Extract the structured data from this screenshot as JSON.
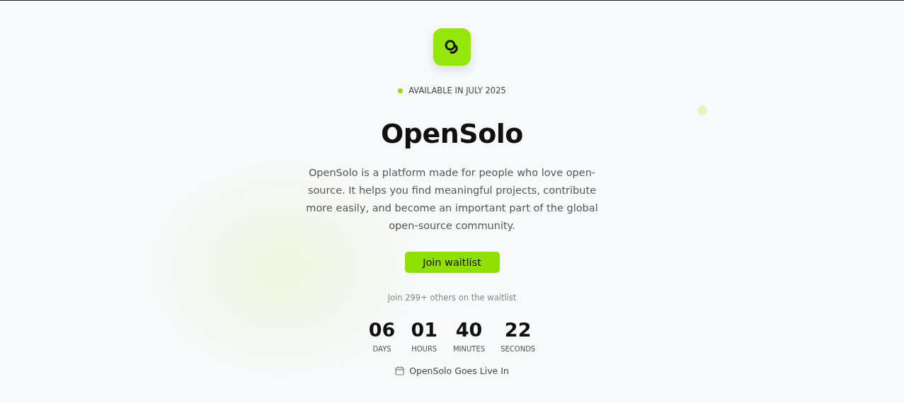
{
  "badge": {
    "text": "AVAILABLE IN JULY 2025",
    "color": "#8ee000"
  },
  "title": "OpenSolo",
  "description": "OpenSolo is a platform made for people who love open-source. It helps you find meaningful projects, contribute more easily, and become an important part of the global open-source community.",
  "cta": {
    "label": "Join waitlist"
  },
  "waitlist_note": "Join 299+ others on the waitlist",
  "countdown": [
    {
      "value": "06",
      "unit": "DAYS"
    },
    {
      "value": "01",
      "unit": "HOURS"
    },
    {
      "value": "40",
      "unit": "MINUTES"
    },
    {
      "value": "22",
      "unit": "SECONDS"
    }
  ],
  "footer_note": "OpenSolo Goes Live In"
}
